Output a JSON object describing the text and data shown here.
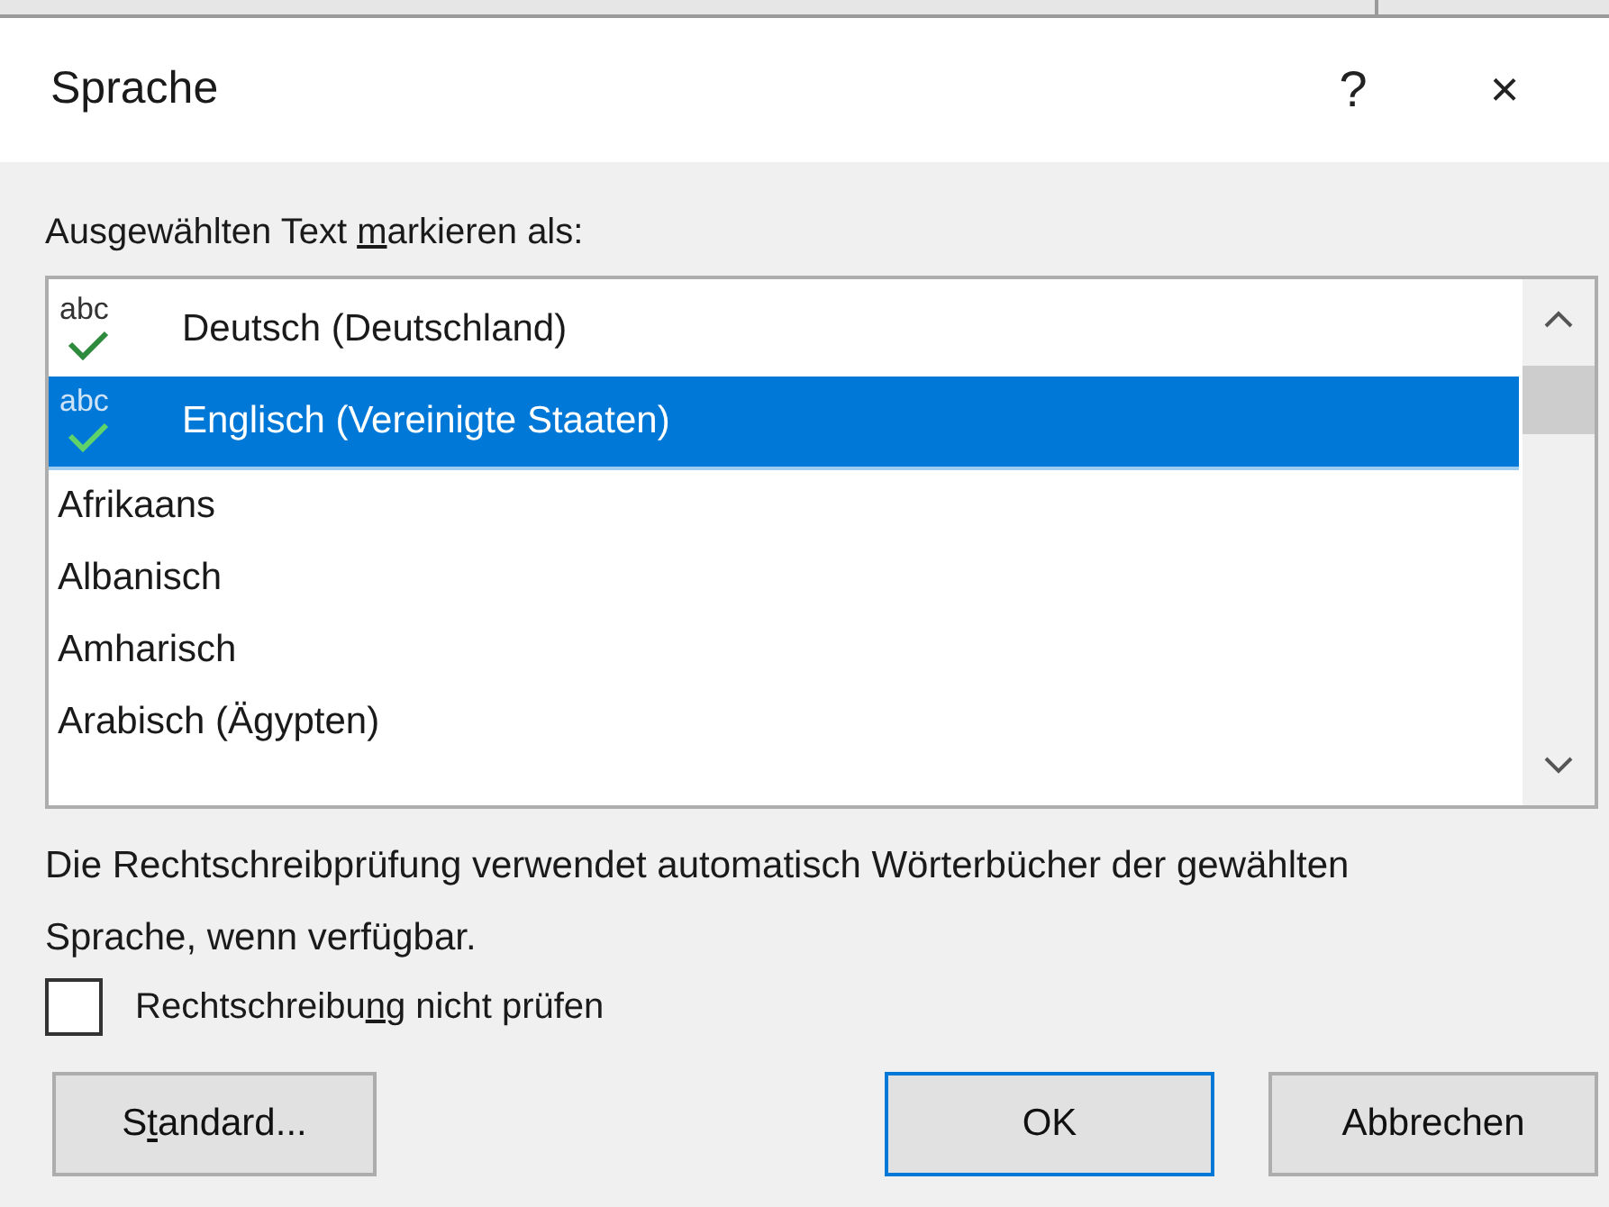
{
  "window": {
    "title": "Sprache",
    "help_button": "?",
    "close_button": "×"
  },
  "list_label": {
    "pre": "Ausgewählten Text ",
    "key": "m",
    "post": "arkieren als:"
  },
  "languages": [
    {
      "label": "Deutsch (Deutschland)",
      "kind": "proofing",
      "icon_text": "abc",
      "selected": false
    },
    {
      "label": "Englisch (Vereinigte Staaten)",
      "kind": "proofing",
      "icon_text": "abc",
      "selected": true
    },
    {
      "label": "Afrikaans",
      "kind": "plain",
      "selected": false
    },
    {
      "label": "Albanisch",
      "kind": "plain",
      "selected": false
    },
    {
      "label": "Amharisch",
      "kind": "plain",
      "selected": false
    },
    {
      "label": "Arabisch (Ägypten)",
      "kind": "plain",
      "selected": false
    }
  ],
  "description": "Die Rechtschreibprüfung verwendet automatisch Wörterbücher der gewählten Sprache, wenn verfügbar.",
  "no_proofing": {
    "label": {
      "pre": "Rechtschreibu",
      "key": "n",
      "post": "g nicht prüfen"
    },
    "checked": false
  },
  "buttons": [
    {
      "label": {
        "pre": "S",
        "key": "t",
        "post": "andard..."
      },
      "kind": "standard",
      "default": false
    },
    {
      "label": {
        "pre": "OK"
      },
      "kind": "ok",
      "default": true
    },
    {
      "label": {
        "pre": "Abbrechen"
      },
      "kind": "cancel",
      "default": false
    }
  ]
}
